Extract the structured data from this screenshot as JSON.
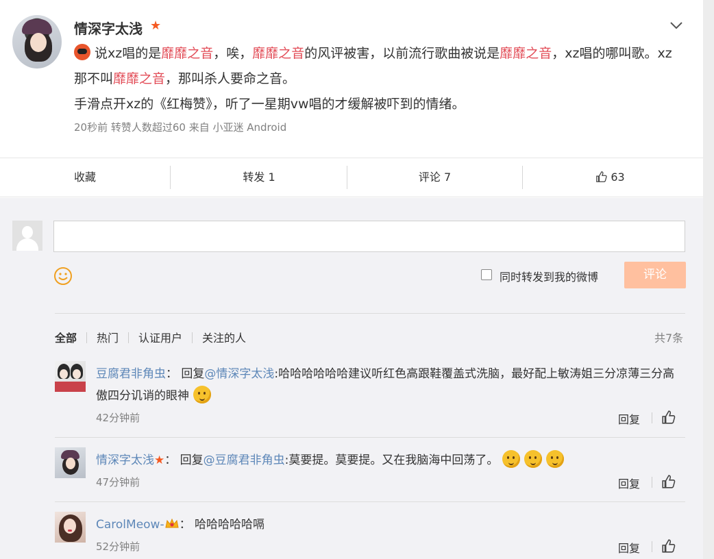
{
  "post": {
    "username": "情深字太浅",
    "content": [
      {
        "text": "说xz唱的是",
        "hl": false
      },
      {
        "text": "靡靡之音",
        "hl": true
      },
      {
        "text": "，唉，",
        "hl": false
      },
      {
        "text": "靡靡之音",
        "hl": true
      },
      {
        "text": "的风评被害，以前流行歌曲被说是",
        "hl": false
      },
      {
        "text": "靡靡之音",
        "hl": true
      },
      {
        "text": "，xz唱的哪叫歌。xz那不叫",
        "hl": false
      },
      {
        "text": "靡靡之音",
        "hl": true
      },
      {
        "text": "，那叫杀人要命之音。",
        "hl": false
      }
    ],
    "line2": "手滑点开xz的《红梅赞》，听了一星期vw唱的才缓解被吓到的情绪。",
    "meta": "20秒前  转赞人数超过60  来自 小亚迷 Android"
  },
  "actions": {
    "favorite": "收藏",
    "repost": "转发 1",
    "comment": "评论 7",
    "likes": "63"
  },
  "composer": {
    "input_value": "",
    "forward_label": "同时转发到我的微博",
    "submit": "评论"
  },
  "filters": {
    "items": [
      "全部",
      "热门",
      "认证用户",
      "关注的人"
    ],
    "active_index": 0,
    "total": "共7条"
  },
  "comments": [
    {
      "author": "豆腐君非角虫",
      "sep": "：",
      "reply_prefix": "回复",
      "reply_to": "@情深字太浅",
      "text": ":哈哈哈哈哈哈建议听红色高跟鞋覆盖式洗脑，最好配上敏涛姐三分凉薄三分高傲四分讥诮的眼神",
      "emoji_count": 1,
      "time": "42分钟前",
      "reply": "回复"
    },
    {
      "author": "情深字太浅",
      "sep": "：",
      "reply_prefix": "回复",
      "reply_to": "@豆腐君非角虫",
      "text": ":莫要提。莫要提。又在我脑海中回荡了。",
      "emoji_count": 3,
      "time": "47分钟前",
      "reply": "回复"
    },
    {
      "author": "CarolMeow-",
      "sep": "：",
      "reply_prefix": "",
      "reply_to": "",
      "text": "哈哈哈哈哈嗝",
      "emoji_count": 0,
      "time": "52分钟前",
      "reply": "回复"
    }
  ],
  "colors": {
    "highlight": "#e24b56",
    "link": "#5d87b8",
    "submit_bg": "#ffc09f",
    "vip_star": "#f55a22"
  },
  "icons": {
    "menu": "chevron-down-icon",
    "like": "thumb-up-icon",
    "emoji": "smile-icon",
    "vip": "star-icon",
    "badge": "crown-icon"
  }
}
